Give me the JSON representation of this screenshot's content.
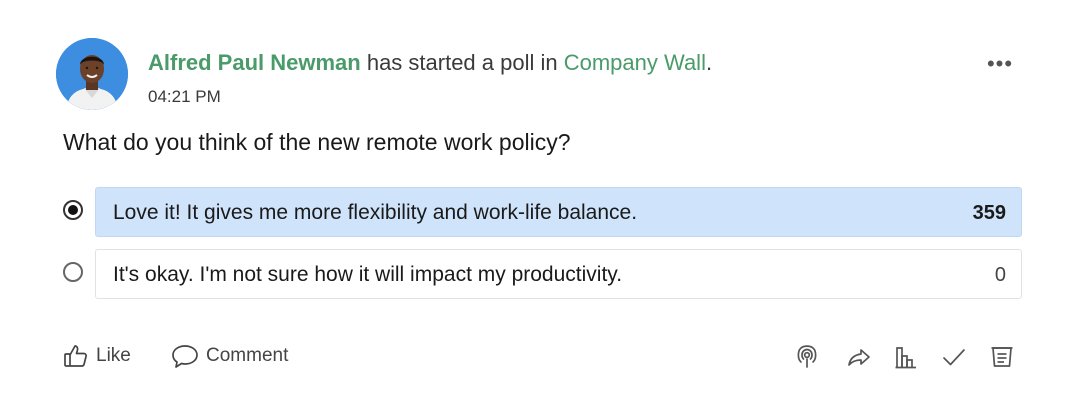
{
  "post": {
    "author": "Alfred Paul Newman",
    "action_text": " has started a poll in ",
    "group": "Company Wall",
    "period": ".",
    "time": "04:21 PM",
    "more_label": "•••"
  },
  "poll": {
    "question": "What do you think of the new remote work policy?",
    "options": [
      {
        "label": "Love it! It gives me more flexibility and work-life balance.",
        "count": "359",
        "selected": true
      },
      {
        "label": "It's okay. I'm not sure how it will impact my productivity.",
        "count": "0",
        "selected": false
      }
    ]
  },
  "actions": {
    "like_label": "Like",
    "comment_label": "Comment"
  },
  "toolbar": {
    "icons": [
      "podcast-icon",
      "share-icon",
      "analytics-icon",
      "check-icon",
      "notes-icon"
    ]
  },
  "colors": {
    "accent_green": "#4a9a6a",
    "selected_option_bg": "#cfe3fb",
    "avatar_bg": "#3d8ee0"
  }
}
